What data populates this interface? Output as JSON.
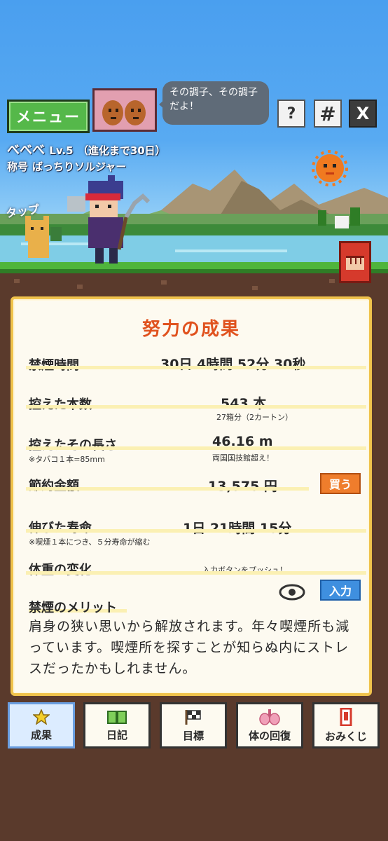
{
  "header": {
    "menu_label": "メニュー",
    "speech": "その調子、その調子だよ！",
    "help_label": "?",
    "hashtag_label": "#",
    "x_label": "X"
  },
  "character": {
    "name": "べべべ",
    "level": "Lv.5",
    "evolution": "（進化まで30日）",
    "title_label": "称号",
    "title_value": "ばっちりソルジャー",
    "tap_label": "タップ"
  },
  "results": {
    "title": "努力の成果",
    "quit_time_label": "禁煙時間",
    "quit_time_value": "30日  4時間  52分  30秒",
    "cigs_label": "控えた本数",
    "cigs_value": "543  本",
    "cigs_sub": "27箱分（2カートン）",
    "length_label": "控えたその長さ",
    "length_note": "※タバコ１本=85mm",
    "length_value": "46.16  m",
    "length_sub": "両国国技館超え！",
    "savings_label": "節約金額",
    "savings_value": "13,575  円",
    "buy_label": "買う",
    "life_label": "伸びた寿命",
    "life_note": "※喫煙１本につき、５分寿命が縮む",
    "life_value": "1日  21時間  15分",
    "weight_label": "体重の変化",
    "weight_prompt": "入力ボタンをプッシュ！",
    "input_label": "入力",
    "merit_title": "禁煙のメリット",
    "merit_text": "肩身の狭い思いから解放されます。年々喫煙所も減っています。喫煙所を探すことが知らぬ内にストレスだったかもしれません。"
  },
  "nav": [
    {
      "label": "成果",
      "icon": "star-icon"
    },
    {
      "label": "日記",
      "icon": "book-icon"
    },
    {
      "label": "目標",
      "icon": "flag-icon"
    },
    {
      "label": "体の回復",
      "icon": "lungs-icon"
    },
    {
      "label": "おみくじ",
      "icon": "omikuji-icon"
    }
  ],
  "colors": {
    "accent": "#e0521e",
    "menu_green": "#55b84a",
    "buy_orange": "#ef7d2c",
    "input_blue": "#3f8fdf",
    "panel_border": "#f0c34c",
    "ground": "#5a3a2c"
  }
}
